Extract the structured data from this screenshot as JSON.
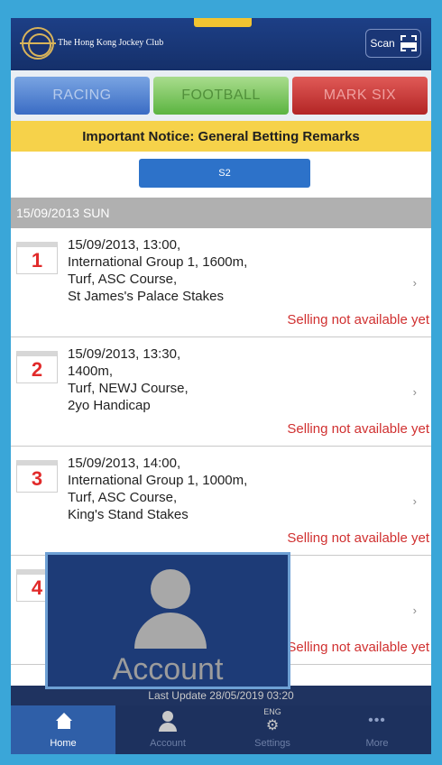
{
  "header": {
    "club_name": "The Hong Kong Jockey Club",
    "scan_label": "Scan"
  },
  "tabs": [
    {
      "label": "RACING"
    },
    {
      "label": "FOOTBALL"
    },
    {
      "label": "MARK SIX"
    }
  ],
  "notice": "Important Notice: General Betting Remarks",
  "segment": "S2",
  "date_header": "15/09/2013 SUN",
  "races": [
    {
      "number": "1",
      "lines": [
        "15/09/2013, 13:00,",
        "International Group 1, 1600m,",
        "Turf, ASC Course,",
        "St James's Palace Stakes"
      ],
      "status": "Selling not available yet",
      "arrow": "›"
    },
    {
      "number": "2",
      "lines": [
        "15/09/2013, 13:30,",
        "1400m,",
        "Turf, NEWJ Course,",
        "2yo Handicap"
      ],
      "status": "Selling not available yet",
      "arrow": "›"
    },
    {
      "number": "3",
      "lines": [
        "15/09/2013, 14:00,",
        "International Group 1, 1000m,",
        "Turf, ASC Course,",
        "King's Stand Stakes"
      ],
      "status": "Selling not available yet",
      "arrow": "›"
    },
    {
      "number": "4",
      "lines": [
        "",
        "",
        "",
        ""
      ],
      "status": "Selling not available yet",
      "arrow": "›"
    }
  ],
  "overlay": {
    "label": "Account",
    "icon": "user-icon"
  },
  "last_update": "Last Update 28/05/2019 03:20",
  "nav": [
    {
      "label": "Home",
      "icon": "home-icon"
    },
    {
      "label": "Account",
      "icon": "user-icon"
    },
    {
      "label": "Settings",
      "icon": "gear-icon",
      "lang": "ENG"
    },
    {
      "label": "More",
      "icon": "more-icon",
      "glyph": "•••"
    }
  ]
}
